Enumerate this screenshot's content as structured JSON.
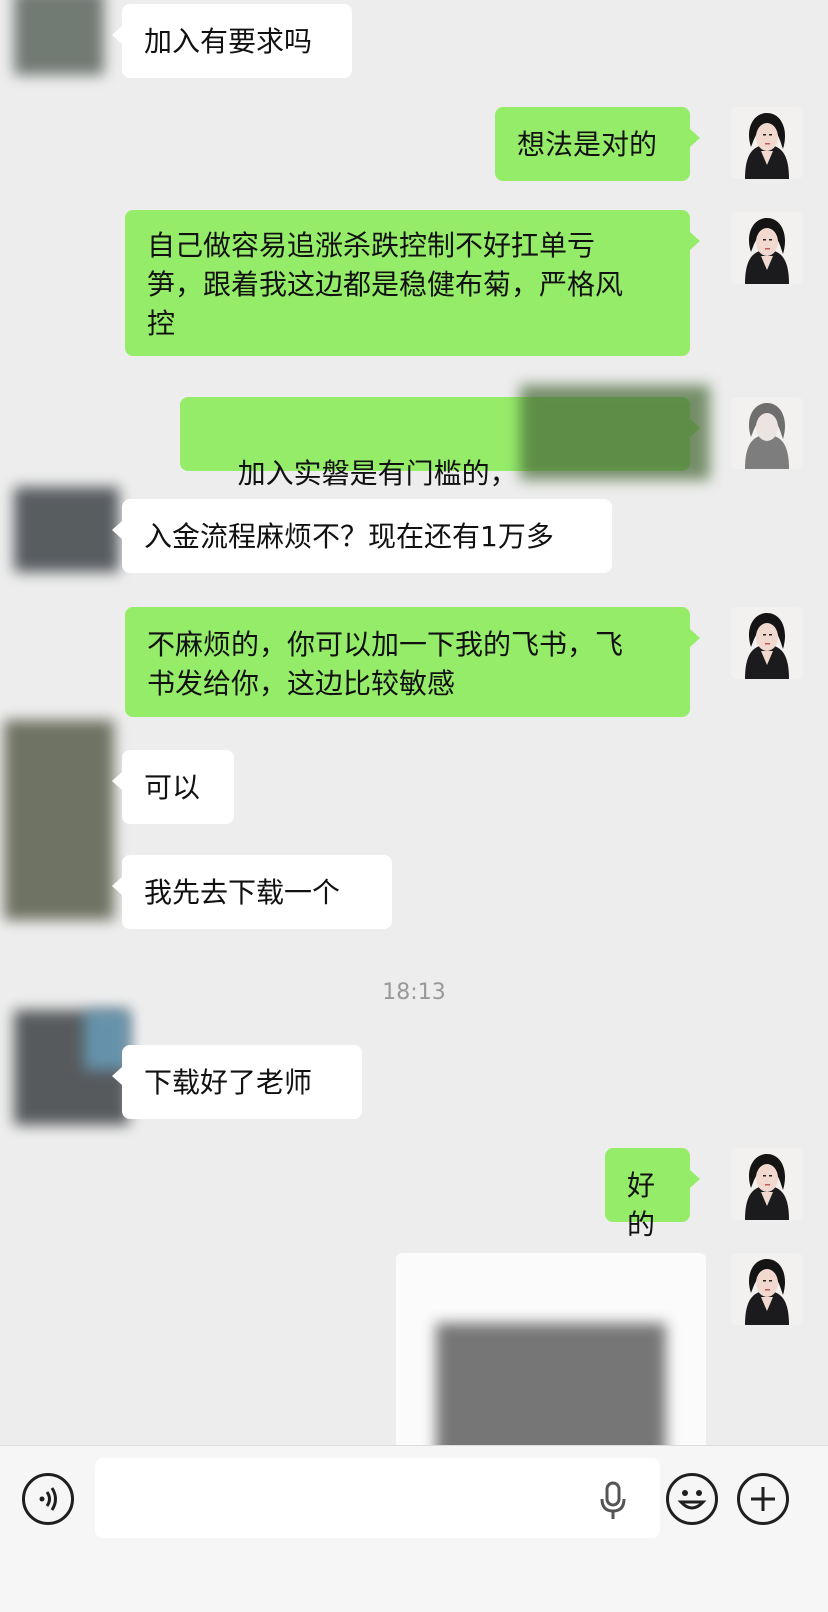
{
  "messages": [
    {
      "side": "in",
      "text": "加入有要求吗"
    },
    {
      "side": "out",
      "text": "想法是对的"
    },
    {
      "side": "out",
      "text": "自己做容易追涨杀跌控制不好扛单亏\n笋，跟着我这边都是稳健布菊，严格风\n控"
    },
    {
      "side": "out",
      "text": "加入实磐是有门槛的，"
    },
    {
      "side": "in",
      "text": "入金流程麻烦不？现在还有1万多"
    },
    {
      "side": "out",
      "text": "不麻烦的，你可以加一下我的飞书，飞\n书发给你，这边比较敏感"
    },
    {
      "side": "in",
      "text": "可以"
    },
    {
      "side": "in",
      "text": "我先去下载一个"
    },
    {
      "side": "in",
      "text": "下载好了老师"
    },
    {
      "side": "out",
      "text": "好的"
    }
  ],
  "timestamp": "18:13",
  "input": {
    "placeholder": ""
  },
  "icons": {
    "voice": "voice-toggle-icon",
    "mic": "microphone-icon",
    "emoji": "emoji-icon",
    "add": "plus-icon"
  },
  "colors": {
    "outgoing": "#95ec69",
    "incoming": "#ffffff",
    "background": "#ededed"
  }
}
